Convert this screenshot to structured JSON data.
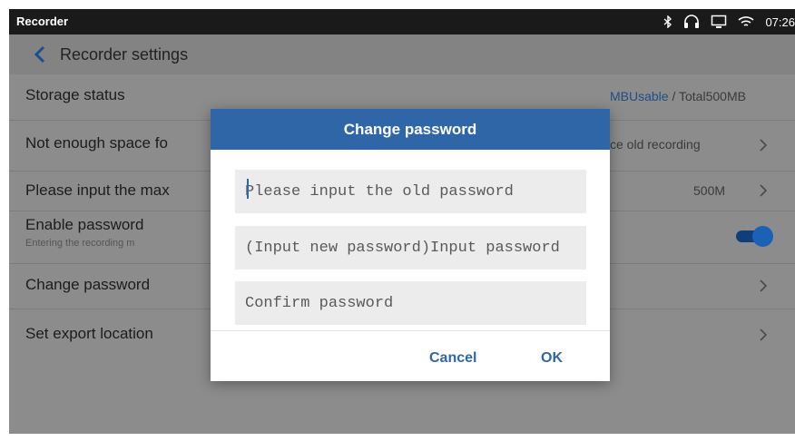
{
  "status_bar": {
    "app_name": "Recorder",
    "time": "07:26"
  },
  "toolbar": {
    "title": "Recorder settings"
  },
  "settings": {
    "storage": {
      "label": "Storage status",
      "usable": "MBUsable",
      "total": " / Total500MB"
    },
    "not_enough_space": {
      "label": "Not enough space fo",
      "value": "ce old recording"
    },
    "max_input": {
      "label": "Please input the max",
      "value": "500M"
    },
    "enable_password": {
      "label": "Enable password",
      "description": "Entering the recording m",
      "enabled": true
    },
    "change_password": {
      "label": "Change password"
    },
    "export_location": {
      "label": "Set export location"
    }
  },
  "dialog": {
    "title": "Change password",
    "old_password_placeholder": "Please input the old password",
    "new_password_placeholder": "(Input new password)Input password",
    "confirm_placeholder": "Confirm password",
    "cancel_label": "Cancel",
    "ok_label": "OK"
  },
  "colors": {
    "accent": "#2f66a8",
    "status_bar": "#1a1a1a",
    "overlay_bg": "#8c8c8c"
  }
}
